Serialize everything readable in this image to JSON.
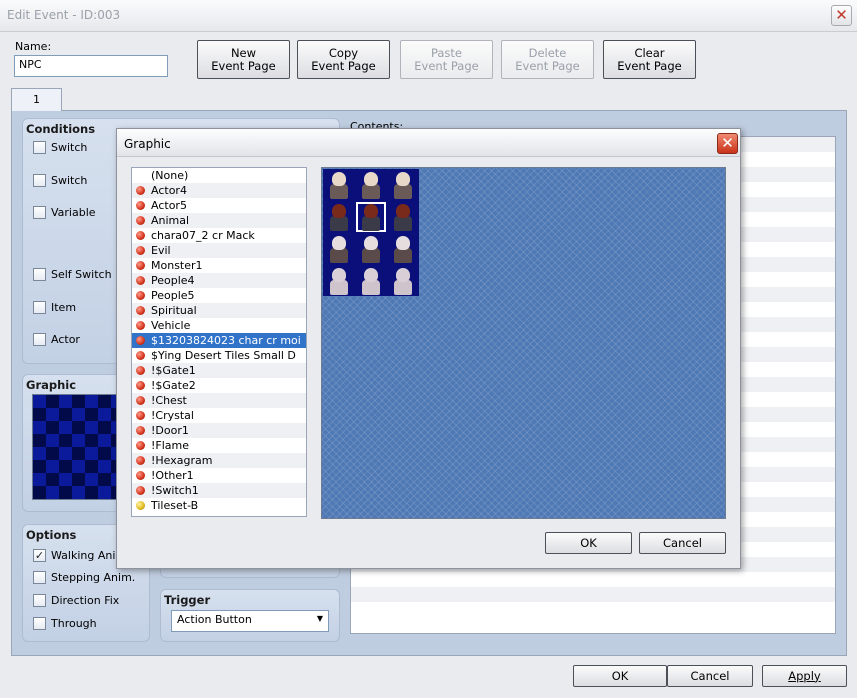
{
  "window": {
    "title": "Edit Event - ID:003"
  },
  "name_field": {
    "label": "Name:",
    "value": "NPC"
  },
  "toolbar": {
    "new_page": [
      "New",
      "Event Page"
    ],
    "copy_page": [
      "Copy",
      "Event Page"
    ],
    "paste_page": [
      "Paste",
      "Event Page"
    ],
    "delete_page": [
      "Delete",
      "Event Page"
    ],
    "clear_page": [
      "Clear",
      "Event Page"
    ]
  },
  "tabs": [
    {
      "label": "1"
    }
  ],
  "conditions": {
    "title": "Conditions",
    "items": [
      {
        "label": "Switch",
        "checked": false
      },
      {
        "label": "Switch",
        "checked": false
      },
      {
        "label": "Variable",
        "checked": false
      },
      {
        "label": "Self Switch",
        "checked": false
      },
      {
        "label": "Item",
        "checked": false
      },
      {
        "label": "Actor",
        "checked": false
      }
    ]
  },
  "graphic_section": {
    "title": "Graphic"
  },
  "options": {
    "title": "Options",
    "items": [
      {
        "label": "Walking Anim.",
        "checked": true
      },
      {
        "label": "Stepping Anim.",
        "checked": false
      },
      {
        "label": "Direction Fix",
        "checked": false
      },
      {
        "label": "Through",
        "checked": false
      }
    ]
  },
  "trigger": {
    "title": "Trigger",
    "value": "Action Button"
  },
  "contents": {
    "label": "Contents:"
  },
  "footer": {
    "ok": "OK",
    "cancel": "Cancel",
    "apply": "Apply"
  },
  "graphic_dialog": {
    "title": "Graphic",
    "files": [
      {
        "name": "(None)",
        "icon": "none"
      },
      {
        "name": "Actor4",
        "icon": "red"
      },
      {
        "name": "Actor5",
        "icon": "red"
      },
      {
        "name": "Animal",
        "icon": "red"
      },
      {
        "name": "chara07_2 cr Mack",
        "icon": "red"
      },
      {
        "name": "Evil",
        "icon": "red"
      },
      {
        "name": "Monster1",
        "icon": "red"
      },
      {
        "name": "People4",
        "icon": "red"
      },
      {
        "name": "People5",
        "icon": "red"
      },
      {
        "name": "Spiritual",
        "icon": "red"
      },
      {
        "name": "Vehicle",
        "icon": "red"
      },
      {
        "name": "$13203824023 char cr moi",
        "icon": "red",
        "selected": true
      },
      {
        "name": "$Ying Desert Tiles Small D",
        "icon": "red"
      },
      {
        "name": "!$Gate1",
        "icon": "red"
      },
      {
        "name": "!$Gate2",
        "icon": "red"
      },
      {
        "name": "!Chest",
        "icon": "red"
      },
      {
        "name": "!Crystal",
        "icon": "red"
      },
      {
        "name": "!Door1",
        "icon": "red"
      },
      {
        "name": "!Flame",
        "icon": "red"
      },
      {
        "name": "!Hexagram",
        "icon": "red"
      },
      {
        "name": "!Other1",
        "icon": "red"
      },
      {
        "name": "!Switch1",
        "icon": "red"
      },
      {
        "name": "Tileset-B",
        "icon": "yellow"
      }
    ],
    "ok": "OK",
    "cancel": "Cancel"
  },
  "colors": {
    "selection": "#3173c9",
    "preview_bg": "#4f79b5",
    "close_red": "#c8321a"
  }
}
